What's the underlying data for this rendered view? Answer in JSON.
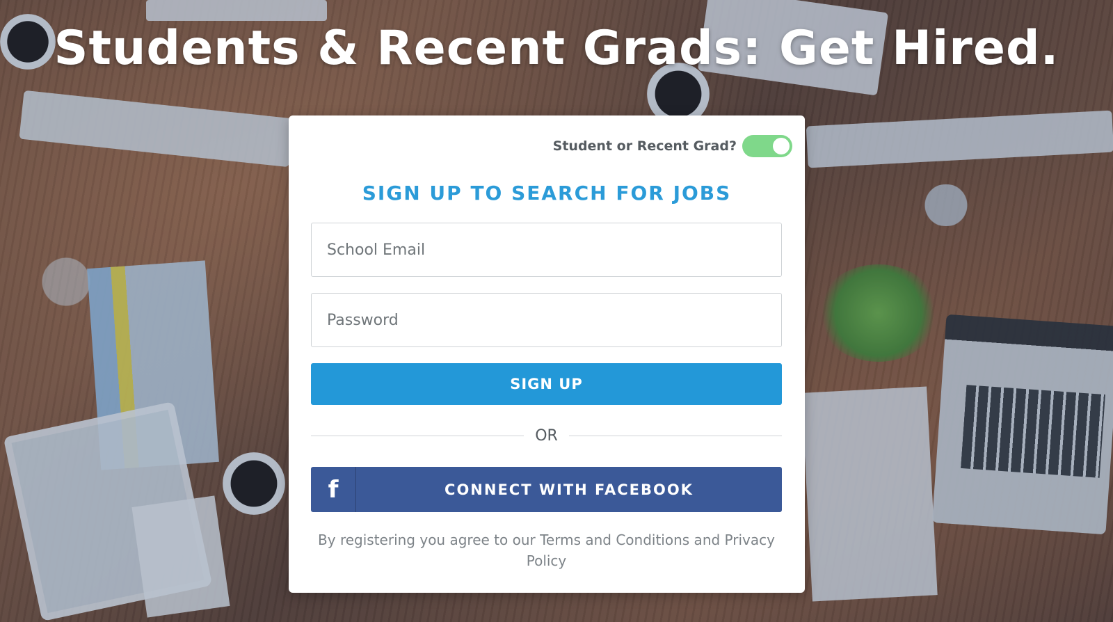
{
  "headline": "Students & Recent Grads: Get Hired.",
  "toggle": {
    "label": "Student or Recent Grad?",
    "state": "on",
    "color": "#7fd88a"
  },
  "form": {
    "title": "SIGN UP TO SEARCH FOR JOBS",
    "email_placeholder": "School Email",
    "password_placeholder": "Password",
    "signup_label": "SIGN UP",
    "divider_text": "OR",
    "facebook_icon": "f",
    "facebook_label": "CONNECT WITH FACEBOOK",
    "legal_prefix": "By registering you agree to our ",
    "terms_link": "Terms and Conditions",
    "legal_and": " and ",
    "privacy_link": "Privacy Policy"
  },
  "colors": {
    "accent": "#2398d8",
    "facebook": "#3b5998",
    "toggle_on": "#7fd88a"
  }
}
